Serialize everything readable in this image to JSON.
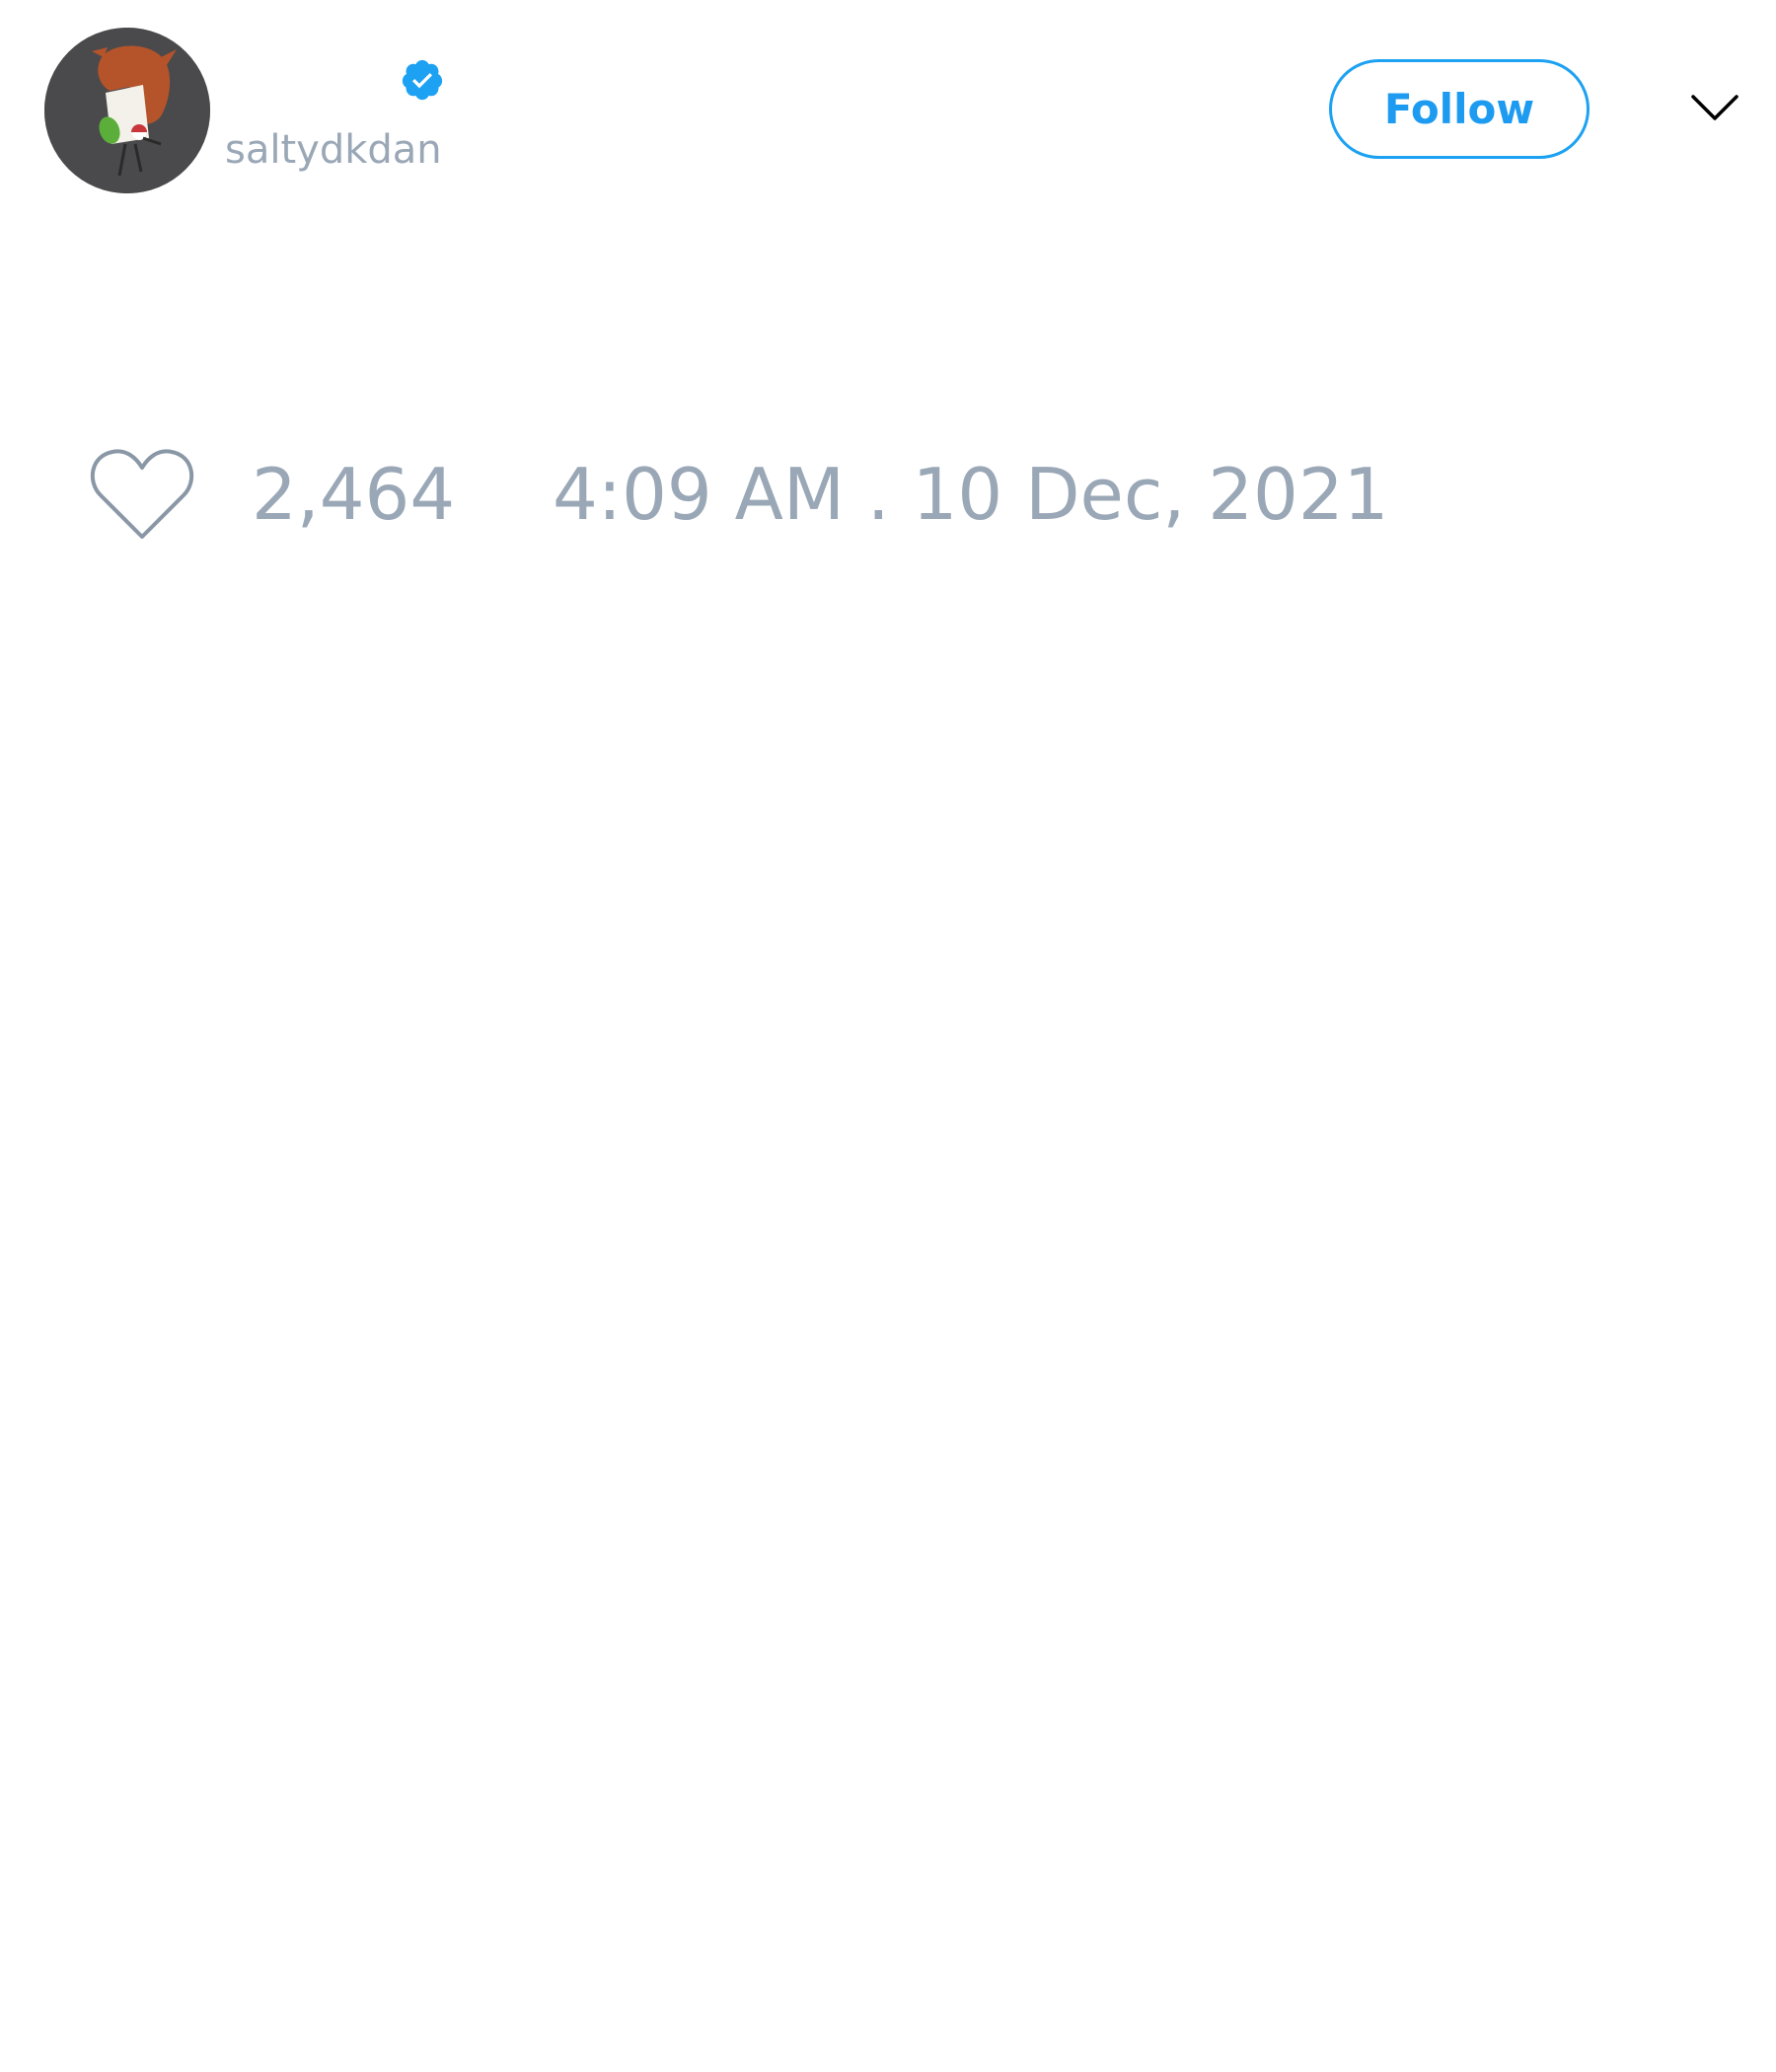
{
  "tweet": {
    "author": {
      "handle": "saltydkdan",
      "verified": true,
      "avatar_icon": "cartoon-character-avatar"
    },
    "follow_label": "Follow",
    "more_icon": "chevron-down-icon",
    "likes": "2,464",
    "timestamp": "4:09 AM . 10 Dec, 2021"
  },
  "colors": {
    "accent": "#1da1f2",
    "muted_text": "#9aa7b6",
    "background": "#ffffff"
  }
}
